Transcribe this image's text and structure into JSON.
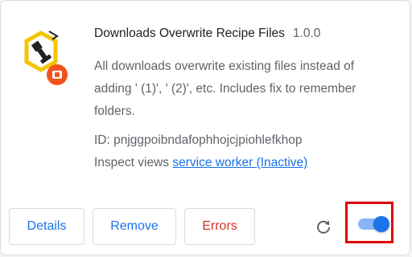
{
  "extension": {
    "icon": "downloads-overwrite-icon",
    "name": "Downloads Overwrite Recipe Files",
    "version": "1.0.0",
    "description": "All downloads overwrite existing files instead of adding ' (1)', ' (2)', etc. Includes fix to remember folders.",
    "id_text": "ID: pnjggpoibndafophhojcjpiohlefkhop",
    "inspect_label": "Inspect views",
    "inspect_link": "service worker (Inactive)",
    "enabled": true
  },
  "buttons": {
    "details": "Details",
    "remove": "Remove",
    "errors": "Errors"
  },
  "icons": {
    "reload": "reload-icon",
    "toggle": "toggle-switch"
  },
  "colors": {
    "accent": "#1a73e8",
    "error": "#d93025",
    "highlight": "#e00000"
  }
}
